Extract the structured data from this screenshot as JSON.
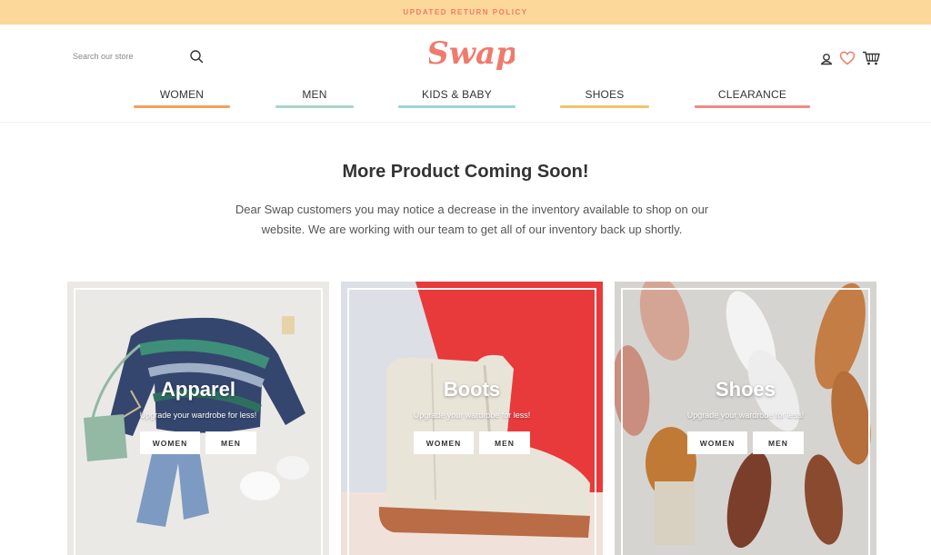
{
  "announcement": {
    "text": "UPDATED RETURN POLICY"
  },
  "header": {
    "search": {
      "placeholder": "Search our store",
      "icon": "search-icon"
    },
    "logo_text": "Swap",
    "icons": [
      "account-icon",
      "heart-icon",
      "cart-icon"
    ]
  },
  "nav": {
    "items": [
      {
        "label": "WOMEN",
        "color": "#f5a05a"
      },
      {
        "label": "MEN",
        "color": "#a6d6c4"
      },
      {
        "label": "KIDS & BABY",
        "color": "#9fd3d9"
      },
      {
        "label": "SHOES",
        "color": "#f4c26a"
      },
      {
        "label": "CLEARANCE",
        "color": "#f28a80"
      }
    ]
  },
  "main": {
    "heading": "More Product Coming Soon!",
    "body": "Dear Swap customers you may notice a decrease in the inventory available to shop on our website. We are working with our team to get all of our inventory back up shortly."
  },
  "categories": [
    {
      "title": "Apparel",
      "subtitle": "Upgrade your wardrobe for less!",
      "women_label": "WOMEN",
      "men_label": "MEN"
    },
    {
      "title": "Boots",
      "subtitle": "Upgrade your wardrobe for less!",
      "women_label": "WOMEN",
      "men_label": "MEN"
    },
    {
      "title": "Shoes",
      "subtitle": "Upgrade your wardrobe for less!",
      "women_label": "WOMEN",
      "men_label": "MEN"
    }
  ],
  "colors": {
    "announce_bg": "#fdd89b",
    "accent": "#f07a6c",
    "boots_red": "#e83a3a"
  }
}
